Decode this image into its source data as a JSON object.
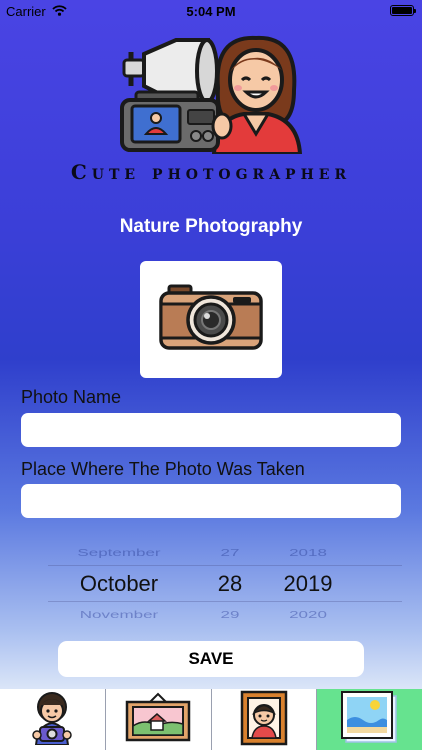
{
  "status_bar": {
    "carrier": "Carrier",
    "time": "5:04 PM"
  },
  "brand": {
    "title": "Cute photographer"
  },
  "page": {
    "title": "Nature Photography"
  },
  "form": {
    "photo_name_label": "Photo Name",
    "photo_name_value": "",
    "place_label": "Place Where The Photo Was Taken",
    "place_value": ""
  },
  "date_picker": {
    "prev": {
      "month": "September",
      "day": "27",
      "year": "2018"
    },
    "selected": {
      "month": "October",
      "day": "28",
      "year": "2019"
    },
    "next": {
      "month": "November",
      "day": "29",
      "year": "2020"
    }
  },
  "save_button": {
    "label": "SAVE"
  },
  "tab_bar": {
    "selected_index": 3,
    "accent": "#66e38f",
    "icons": [
      "photographer-icon",
      "landscape-frame-icon",
      "portrait-frame-icon",
      "beach-photo-icon"
    ]
  },
  "colors": {
    "gradient_top": "#4a44e4",
    "gradient_mid": "#2f3fcc",
    "gradient_bottom": "#ffffff"
  }
}
